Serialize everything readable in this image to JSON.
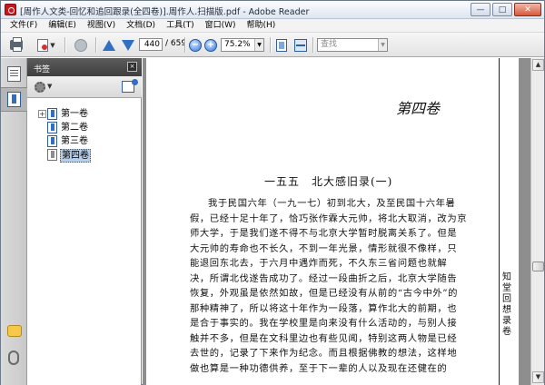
{
  "window": {
    "title": "[周作人文类-回忆和追回跟录(全四卷)].周作人.扫描版.pdf - Adobe Reader"
  },
  "menu": {
    "items": [
      "文件(F)",
      "编辑(E)",
      "视图(V)",
      "文档(D)",
      "工具(T)",
      "窗口(W)",
      "帮助(H)"
    ]
  },
  "toolbar": {
    "current_page": "440",
    "total_pages": "/ 659",
    "zoom_minus": "−",
    "zoom_plus": "+",
    "zoom_value": "75.2%",
    "search_placeholder": "查找"
  },
  "panel": {
    "title": "书签",
    "close_glyph": "×"
  },
  "bookmarks": [
    {
      "label": "第一卷",
      "expander": "+",
      "selected": false
    },
    {
      "label": "第二卷",
      "expander": "",
      "selected": false
    },
    {
      "label": "第三卷",
      "expander": "",
      "selected": false
    },
    {
      "label": "第四卷",
      "expander": "",
      "selected": true
    }
  ],
  "document": {
    "volume_title": "第四卷",
    "section_title": "一五五　北大感旧录(一)",
    "body_lines": [
      "我于民国六年（一九一七）初到北大，及至民国十六年暑",
      "假，已经十足十年了，恰巧张作霖大元帅，将北大取消，改为京",
      "师大学，于是我们遂不得不与北京大学暂时脱离关系了。但是",
      "大元帅的寿命也不长久，不到一年光景，情形就很不像样，只",
      "能退回东北去，于六月中遇炸而死，不久东三省问题也就解",
      "决，所谓北伐遂告成功了。经过一段曲折之后，北京大学随告",
      "恢复，外观虽是依然如故，但是已经没有从前的“古今中外”的",
      "那种精神了，所以将这十年作为一段落，算作北大的前期，也",
      "是合于事实的。我在学校里是向来没有什么活动的，与别人接",
      "触并不多，但是在文科里边也有些见闻，特别这两人物是已经",
      "去世的，记录了下来作为纪念。而且根据佛教的想法，这样地",
      "做也算是一种功德供养，至于下一辈的人以及现在还健在的"
    ],
    "margin_text": "知堂回想录卷"
  },
  "scrollbar": {
    "up_glyph": "▲",
    "down_glyph": "▼"
  }
}
